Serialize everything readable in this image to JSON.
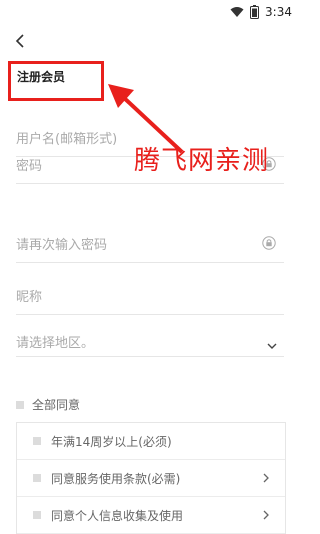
{
  "status": {
    "time": "3:34"
  },
  "page": {
    "title": "注册会员"
  },
  "fields": [
    {
      "placeholder": "用户名(邮箱形式)"
    },
    {
      "placeholder": "密码"
    },
    {
      "placeholder": "请再次输入密码"
    },
    {
      "placeholder": "昵称"
    },
    {
      "placeholder": "请选择地区。"
    }
  ],
  "watermark": "腾飞网亲测",
  "agree": {
    "all_label": "全部同意"
  },
  "terms": [
    {
      "label": "年满14周岁以上(必须)"
    },
    {
      "label": "同意服务使用条款(必需)"
    },
    {
      "label": "同意个人信息收集及使用"
    }
  ],
  "colors": {
    "annotation": "#e8201c"
  }
}
